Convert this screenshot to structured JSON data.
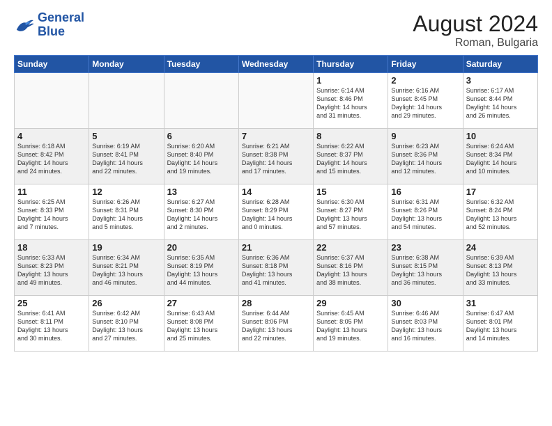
{
  "logo": {
    "line1": "General",
    "line2": "Blue"
  },
  "title": "August 2024",
  "location": "Roman, Bulgaria",
  "weekdays": [
    "Sunday",
    "Monday",
    "Tuesday",
    "Wednesday",
    "Thursday",
    "Friday",
    "Saturday"
  ],
  "weeks": [
    [
      {
        "day": "",
        "info": ""
      },
      {
        "day": "",
        "info": ""
      },
      {
        "day": "",
        "info": ""
      },
      {
        "day": "",
        "info": ""
      },
      {
        "day": "1",
        "info": "Sunrise: 6:14 AM\nSunset: 8:46 PM\nDaylight: 14 hours\nand 31 minutes."
      },
      {
        "day": "2",
        "info": "Sunrise: 6:16 AM\nSunset: 8:45 PM\nDaylight: 14 hours\nand 29 minutes."
      },
      {
        "day": "3",
        "info": "Sunrise: 6:17 AM\nSunset: 8:44 PM\nDaylight: 14 hours\nand 26 minutes."
      }
    ],
    [
      {
        "day": "4",
        "info": "Sunrise: 6:18 AM\nSunset: 8:42 PM\nDaylight: 14 hours\nand 24 minutes."
      },
      {
        "day": "5",
        "info": "Sunrise: 6:19 AM\nSunset: 8:41 PM\nDaylight: 14 hours\nand 22 minutes."
      },
      {
        "day": "6",
        "info": "Sunrise: 6:20 AM\nSunset: 8:40 PM\nDaylight: 14 hours\nand 19 minutes."
      },
      {
        "day": "7",
        "info": "Sunrise: 6:21 AM\nSunset: 8:38 PM\nDaylight: 14 hours\nand 17 minutes."
      },
      {
        "day": "8",
        "info": "Sunrise: 6:22 AM\nSunset: 8:37 PM\nDaylight: 14 hours\nand 15 minutes."
      },
      {
        "day": "9",
        "info": "Sunrise: 6:23 AM\nSunset: 8:36 PM\nDaylight: 14 hours\nand 12 minutes."
      },
      {
        "day": "10",
        "info": "Sunrise: 6:24 AM\nSunset: 8:34 PM\nDaylight: 14 hours\nand 10 minutes."
      }
    ],
    [
      {
        "day": "11",
        "info": "Sunrise: 6:25 AM\nSunset: 8:33 PM\nDaylight: 14 hours\nand 7 minutes."
      },
      {
        "day": "12",
        "info": "Sunrise: 6:26 AM\nSunset: 8:31 PM\nDaylight: 14 hours\nand 5 minutes."
      },
      {
        "day": "13",
        "info": "Sunrise: 6:27 AM\nSunset: 8:30 PM\nDaylight: 14 hours\nand 2 minutes."
      },
      {
        "day": "14",
        "info": "Sunrise: 6:28 AM\nSunset: 8:29 PM\nDaylight: 14 hours\nand 0 minutes."
      },
      {
        "day": "15",
        "info": "Sunrise: 6:30 AM\nSunset: 8:27 PM\nDaylight: 13 hours\nand 57 minutes."
      },
      {
        "day": "16",
        "info": "Sunrise: 6:31 AM\nSunset: 8:26 PM\nDaylight: 13 hours\nand 54 minutes."
      },
      {
        "day": "17",
        "info": "Sunrise: 6:32 AM\nSunset: 8:24 PM\nDaylight: 13 hours\nand 52 minutes."
      }
    ],
    [
      {
        "day": "18",
        "info": "Sunrise: 6:33 AM\nSunset: 8:23 PM\nDaylight: 13 hours\nand 49 minutes."
      },
      {
        "day": "19",
        "info": "Sunrise: 6:34 AM\nSunset: 8:21 PM\nDaylight: 13 hours\nand 46 minutes."
      },
      {
        "day": "20",
        "info": "Sunrise: 6:35 AM\nSunset: 8:19 PM\nDaylight: 13 hours\nand 44 minutes."
      },
      {
        "day": "21",
        "info": "Sunrise: 6:36 AM\nSunset: 8:18 PM\nDaylight: 13 hours\nand 41 minutes."
      },
      {
        "day": "22",
        "info": "Sunrise: 6:37 AM\nSunset: 8:16 PM\nDaylight: 13 hours\nand 38 minutes."
      },
      {
        "day": "23",
        "info": "Sunrise: 6:38 AM\nSunset: 8:15 PM\nDaylight: 13 hours\nand 36 minutes."
      },
      {
        "day": "24",
        "info": "Sunrise: 6:39 AM\nSunset: 8:13 PM\nDaylight: 13 hours\nand 33 minutes."
      }
    ],
    [
      {
        "day": "25",
        "info": "Sunrise: 6:41 AM\nSunset: 8:11 PM\nDaylight: 13 hours\nand 30 minutes."
      },
      {
        "day": "26",
        "info": "Sunrise: 6:42 AM\nSunset: 8:10 PM\nDaylight: 13 hours\nand 27 minutes."
      },
      {
        "day": "27",
        "info": "Sunrise: 6:43 AM\nSunset: 8:08 PM\nDaylight: 13 hours\nand 25 minutes."
      },
      {
        "day": "28",
        "info": "Sunrise: 6:44 AM\nSunset: 8:06 PM\nDaylight: 13 hours\nand 22 minutes."
      },
      {
        "day": "29",
        "info": "Sunrise: 6:45 AM\nSunset: 8:05 PM\nDaylight: 13 hours\nand 19 minutes."
      },
      {
        "day": "30",
        "info": "Sunrise: 6:46 AM\nSunset: 8:03 PM\nDaylight: 13 hours\nand 16 minutes."
      },
      {
        "day": "31",
        "info": "Sunrise: 6:47 AM\nSunset: 8:01 PM\nDaylight: 13 hours\nand 14 minutes."
      }
    ]
  ]
}
